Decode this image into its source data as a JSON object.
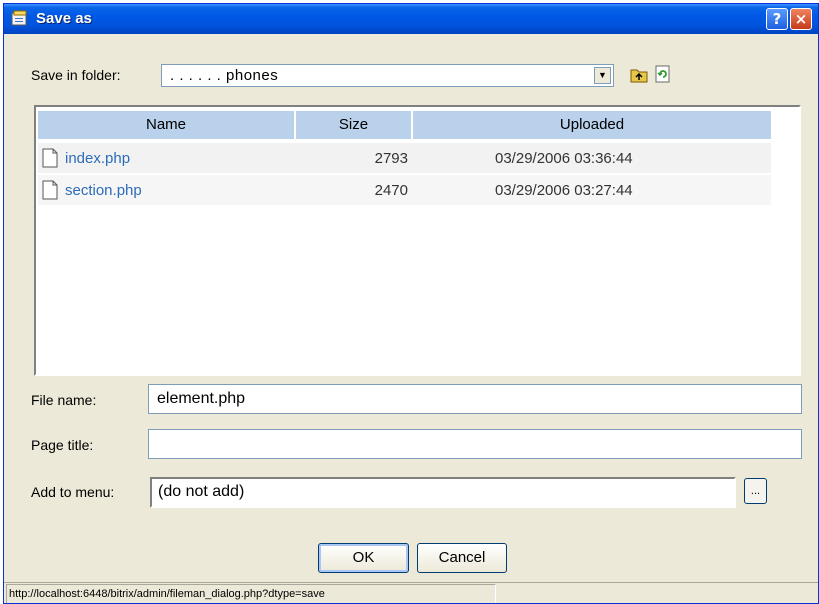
{
  "window": {
    "title": "Save as",
    "help_label": "?",
    "close_label": "×"
  },
  "folder": {
    "label": "Save in folder:",
    "value": ". . . . . . phones"
  },
  "filelist": {
    "columns": [
      "Name",
      "Size",
      "Uploaded"
    ],
    "rows": [
      {
        "name": "index.php",
        "size": "2793",
        "uploaded": "03/29/2006 03:36:44"
      },
      {
        "name": "section.php",
        "size": "2470",
        "uploaded": "03/29/2006 03:27:44"
      }
    ]
  },
  "form": {
    "file_name_label": "File name:",
    "file_name_value": "element.php",
    "page_title_label": "Page title:",
    "page_title_value": "",
    "menu_label": "Add to menu:",
    "menu_value": "(do not add)",
    "dots_label": "..."
  },
  "buttons": {
    "ok": "OK",
    "cancel": "Cancel"
  },
  "status": {
    "url": "http://localhost:6448/bitrix/admin/fileman_dialog.php?dtype=save"
  },
  "colors": {
    "title_bar": "#0054dd",
    "header_bg": "#b9d1ea",
    "link": "#2c6cb8"
  },
  "icons": {
    "title": "save-as-icon",
    "up": "folder-up-icon",
    "refresh": "refresh-icon",
    "file": "document-icon"
  }
}
